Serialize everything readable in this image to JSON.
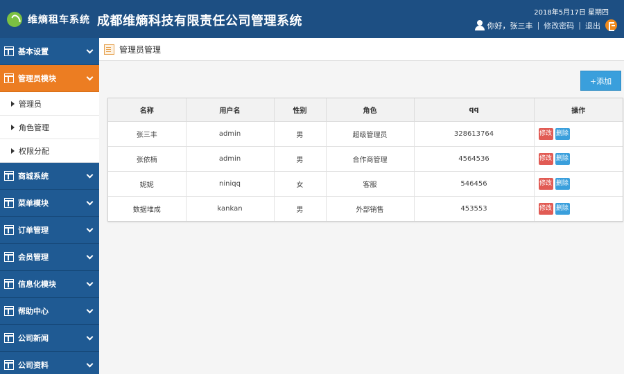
{
  "header": {
    "logo_text": "维熵租车系统",
    "system_title": "成都维熵科技有限责任公司管理系统",
    "date": "2018年5月17日 星期四",
    "greeting": "你好，张三丰",
    "change_password": "修改密码",
    "logout": "退出"
  },
  "sidebar": {
    "items": [
      {
        "label": "基本设置"
      },
      {
        "label": "管理员模块",
        "active": true
      },
      {
        "label": "商城系统"
      },
      {
        "label": "菜单模块"
      },
      {
        "label": "订单管理"
      },
      {
        "label": "会员管理"
      },
      {
        "label": "信息化模块"
      },
      {
        "label": "帮助中心"
      },
      {
        "label": "公司新闻"
      },
      {
        "label": "公司资料"
      }
    ],
    "subitems": [
      {
        "label": "管理员"
      },
      {
        "label": "角色管理"
      },
      {
        "label": "权限分配"
      }
    ]
  },
  "main": {
    "breadcrumb": "管理员管理",
    "add_label": "+添加",
    "columns": [
      "名称",
      "用户名",
      "性别",
      "角色",
      "qq",
      "操作"
    ],
    "rows": [
      {
        "name": "张三丰",
        "username": "admin",
        "gender": "男",
        "role": "超级管理员",
        "qq": "328613764"
      },
      {
        "name": "张依楠",
        "username": "admin",
        "gender": "男",
        "role": "合作商管理",
        "qq": "4564536"
      },
      {
        "name": "妮妮",
        "username": "niniqq",
        "gender": "女",
        "role": "客服",
        "qq": "546456"
      },
      {
        "name": "数据堆成",
        "username": "kankan",
        "gender": "男",
        "role": "外部销售",
        "qq": "453553"
      }
    ],
    "edit_label": "修改",
    "delete_label": "删除"
  },
  "colors": {
    "header_bg": "#1d4f83",
    "sidebar_bg": "#1f5a93",
    "active_item": "#ec7d22",
    "add_button": "#3a9fdc",
    "edit_button": "#e15b54",
    "delete_button": "#3a9fdc"
  }
}
